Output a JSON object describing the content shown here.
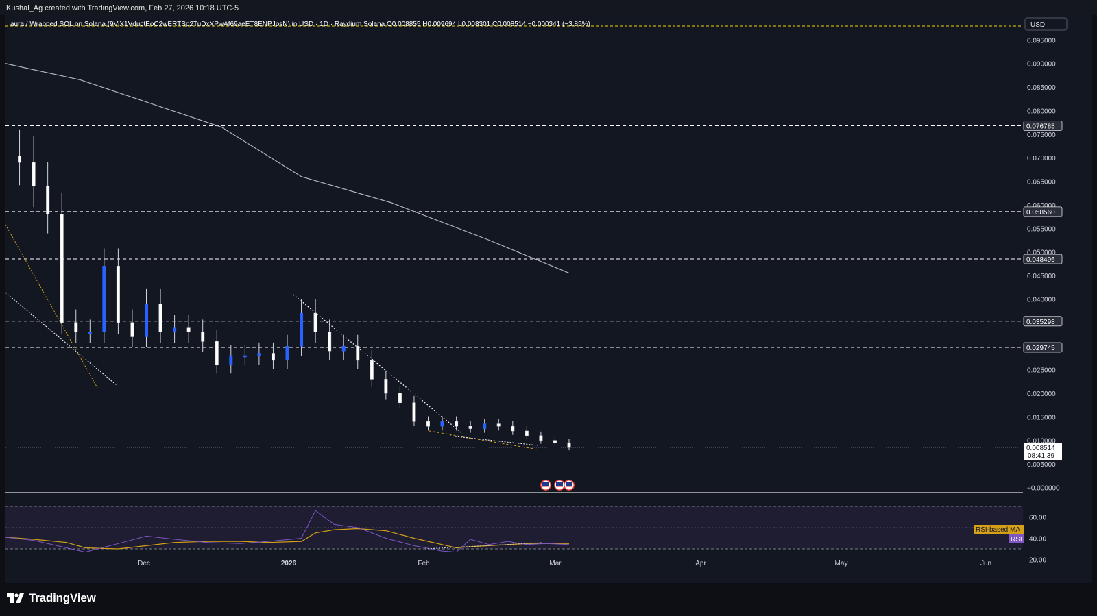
{
  "credit": "Kushal_Ag created with TradingView.com, Feb 27, 2026 10:18 UTC-5",
  "symbol_line": "aura / Wrapped SOL on Solana (9ViX1VductEoC2wERTSp2TuDxXPwAf69aeET8ENPJpsN) in USD · 1D · Raydium Solana  O0.008855  H0.009694  L0.008301  C0.008514  −0.000341 (−3.85%)",
  "currency_label": "USD",
  "brand": "TradingView",
  "colors": {
    "background": "#131722",
    "up_candle": "#2962ff",
    "down_candle": "#ffffff",
    "dashed_levels": "#ffffff",
    "top_level": "#f0d000",
    "ma_line": "#b2b5be",
    "rsi": "#7e57c2",
    "rsi_ma": "#d4a017"
  },
  "chart_data": [
    {
      "type": "line",
      "panel": "price",
      "subtype": "candlestick",
      "x_tick_labels": [
        "Dec",
        "2026",
        "Feb",
        "Mar",
        "Apr",
        "May",
        "Jun"
      ],
      "y_tick_labels": [
        "0.095000",
        "0.090000",
        "0.085000",
        "0.080000",
        "0.075000",
        "0.070000",
        "0.065000",
        "0.060000",
        "0.055000",
        "0.050000",
        "0.045000",
        "0.040000",
        "0.025000",
        "0.020000",
        "0.015000",
        "0.010000",
        "0.005000",
        "−0.000000"
      ],
      "ylim": [
        0,
        0.097
      ],
      "horizontal_levels": [
        0.076785,
        0.05856,
        0.048496,
        0.035298,
        0.029745
      ],
      "level_labels": [
        "0.076785",
        "0.058560",
        "0.048496",
        "0.035298",
        "0.029745"
      ],
      "top_level_value": 0.0965,
      "last_price_label": "0.008514",
      "countdown_label": "08:41:39",
      "last_price": 0.008514,
      "close_series": {
        "x": [
          "2025-11-02",
          "2025-11-05",
          "2025-11-08",
          "2025-11-11",
          "2025-11-14",
          "2025-11-17",
          "2025-11-20",
          "2025-11-23",
          "2025-11-26",
          "2025-11-29",
          "2025-12-02",
          "2025-12-05",
          "2025-12-08",
          "2025-12-11",
          "2025-12-14",
          "2025-12-17",
          "2025-12-20",
          "2025-12-23",
          "2025-12-26",
          "2025-12-29",
          "2026-01-01",
          "2026-01-04",
          "2026-01-07",
          "2026-01-10",
          "2026-01-13",
          "2026-01-16",
          "2026-01-19",
          "2026-01-22",
          "2026-01-25",
          "2026-01-28",
          "2026-01-31",
          "2026-02-03",
          "2026-02-06",
          "2026-02-09",
          "2026-02-12",
          "2026-02-15",
          "2026-02-18",
          "2026-02-21",
          "2026-02-24",
          "2026-02-27"
        ],
        "close": [
          0.069,
          0.064,
          0.058,
          0.035,
          0.033,
          0.033,
          0.047,
          0.035,
          0.032,
          0.039,
          0.033,
          0.034,
          0.033,
          0.031,
          0.026,
          0.028,
          0.028,
          0.0285,
          0.027,
          0.03,
          0.037,
          0.033,
          0.029,
          0.03,
          0.027,
          0.023,
          0.02,
          0.018,
          0.014,
          0.013,
          0.014,
          0.013,
          0.0125,
          0.0135,
          0.013,
          0.012,
          0.011,
          0.01,
          0.0095,
          0.0085
        ]
      },
      "moving_average": {
        "x": [
          "2025-10-30",
          "2025-11-15",
          "2025-12-15",
          "2026-01-01",
          "2026-01-20",
          "2026-02-10",
          "2026-02-27"
        ],
        "y": [
          0.09,
          0.0865,
          0.0765,
          0.066,
          0.0605,
          0.0525,
          0.0455
        ]
      }
    },
    {
      "type": "line",
      "panel": "rsi",
      "y_tick_labels": [
        "60.00",
        "40.00",
        "20.00"
      ],
      "ylim": [
        14,
        78
      ],
      "band": [
        30,
        70
      ],
      "middle": 50,
      "series_labels": [
        "RSI-based MA",
        "RSI"
      ],
      "x": [
        "2025-10-30",
        "2025-11-05",
        "2025-11-12",
        "2025-11-16",
        "2025-11-23",
        "2025-11-29",
        "2025-12-05",
        "2025-12-12",
        "2025-12-19",
        "2025-12-25",
        "2026-01-01",
        "2026-01-04",
        "2026-01-08",
        "2026-01-13",
        "2026-01-19",
        "2026-01-25",
        "2026-01-31",
        "2026-02-03",
        "2026-02-06",
        "2026-02-10",
        "2026-02-14",
        "2026-02-18",
        "2026-02-22",
        "2026-02-27"
      ],
      "rsi": [
        41,
        38,
        31,
        27,
        35,
        42,
        39,
        36,
        35,
        37,
        40,
        66,
        53,
        50,
        40,
        33,
        28,
        27,
        39,
        34,
        37,
        34,
        35,
        34
      ],
      "rsi_ma": [
        41,
        39,
        36,
        31,
        30,
        33,
        36,
        37,
        37,
        36,
        37,
        45,
        48,
        49,
        47,
        40,
        34,
        31,
        32,
        33,
        34,
        35,
        35,
        35
      ]
    }
  ]
}
